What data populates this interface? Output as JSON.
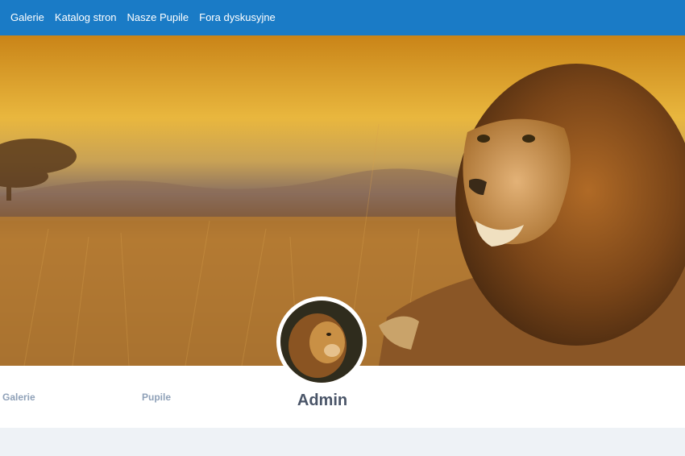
{
  "topnav": {
    "items": [
      {
        "label": "Galerie"
      },
      {
        "label": "Katalog stron"
      },
      {
        "label": "Nasze Pupile"
      },
      {
        "label": "Fora dyskusyjne"
      }
    ]
  },
  "profile": {
    "links": [
      {
        "label": "Galerie"
      },
      {
        "label": "Pupile"
      }
    ],
    "name": "Admin"
  },
  "icons": {
    "cover": "lion-savanna-cover-image",
    "avatar": "lion-avatar-image"
  }
}
